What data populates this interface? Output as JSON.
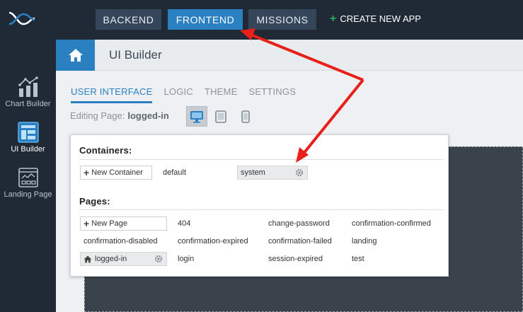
{
  "topbar": {
    "backend_label": "BACKEND",
    "frontend_label": "FRONTEND",
    "missions_label": "MISSIONS",
    "create_app_label": "CREATE NEW APP",
    "active_color": "#2b80c1"
  },
  "sidebar": {
    "items": [
      {
        "label": "Chart Builder",
        "icon": "chart-icon"
      },
      {
        "label": "UI Builder",
        "icon": "layout-icon"
      },
      {
        "label": "Landing Page",
        "icon": "landing-page-icon"
      }
    ]
  },
  "header": {
    "title": "UI Builder"
  },
  "tabs": [
    {
      "label": "USER INTERFACE",
      "active": true
    },
    {
      "label": "LOGIC",
      "active": false
    },
    {
      "label": "THEME",
      "active": false
    },
    {
      "label": "SETTINGS",
      "active": false
    }
  ],
  "editing": {
    "prefix": "Editing Page:",
    "page": "logged-in"
  },
  "popup": {
    "containers_title": "Containers:",
    "new_container_label": "New Container",
    "containers": [
      "default",
      "system"
    ],
    "pages_title": "Pages:",
    "new_page_label": "New Page",
    "pages": [
      "404",
      "change-password",
      "confirmation-confirmed",
      "confirmation-disabled",
      "confirmation-expired",
      "confirmation-failed",
      "landing",
      "logged-in",
      "login",
      "session-expired",
      "test"
    ]
  },
  "annotation": {
    "arrow_color": "#e8201a"
  }
}
